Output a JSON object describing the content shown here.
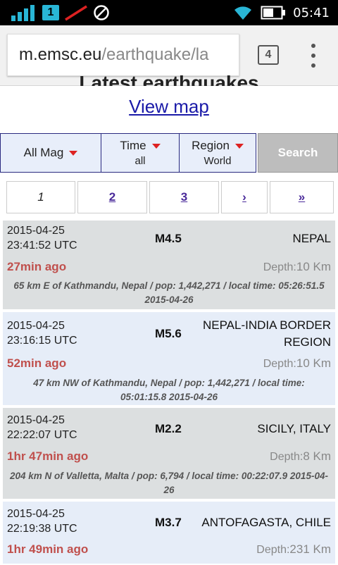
{
  "status_bar": {
    "sim_badge": "1",
    "time": "05:41"
  },
  "browser": {
    "url_host": "m.emsc.eu",
    "url_path": "/earthquake/la",
    "tab_count": "4"
  },
  "page": {
    "heading": "Latest earthquakes",
    "view_map": "View map"
  },
  "filters": {
    "mag": {
      "label": "All Mag"
    },
    "time": {
      "label": "Time",
      "value": "all"
    },
    "region": {
      "label": "Region",
      "value": "World"
    },
    "search": "Search"
  },
  "pagination": {
    "current": "1",
    "p2": "2",
    "p3": "3",
    "next": "›",
    "last": "»"
  },
  "quakes": [
    {
      "date": "2015-04-25",
      "time": "23:41:52 UTC",
      "mag": "M4.5",
      "region": "NEPAL",
      "ago": "27min ago",
      "depth_label": "Depth:",
      "depth": "10 Km",
      "info": "65 km E of Kathmandu, Nepal / pop: 1,442,271 / local time: 05:26:51.5 2015-04-26"
    },
    {
      "date": "2015-04-25",
      "time": "23:16:15 UTC",
      "mag": "M5.6",
      "region": "NEPAL-INDIA BORDER REGION",
      "ago": "52min ago",
      "depth_label": "Depth:",
      "depth": "10 Km",
      "info": "47 km NW of Kathmandu, Nepal / pop: 1,442,271 / local time: 05:01:15.8 2015-04-26"
    },
    {
      "date": "2015-04-25",
      "time": "22:22:07 UTC",
      "mag": "M2.2",
      "region": "SICILY, ITALY",
      "ago": "1hr 47min ago",
      "depth_label": "Depth:",
      "depth": "8 Km",
      "info": "204 km N of Valletta, Malta / pop: 6,794 / local time: 00:22:07.9 2015-04-26"
    },
    {
      "date": "2015-04-25",
      "time": "22:19:38 UTC",
      "mag": "M3.7",
      "region": "ANTOFAGASTA, CHILE",
      "ago": "1hr 49min ago",
      "depth_label": "Depth:",
      "depth": "231 Km",
      "info": ""
    }
  ]
}
